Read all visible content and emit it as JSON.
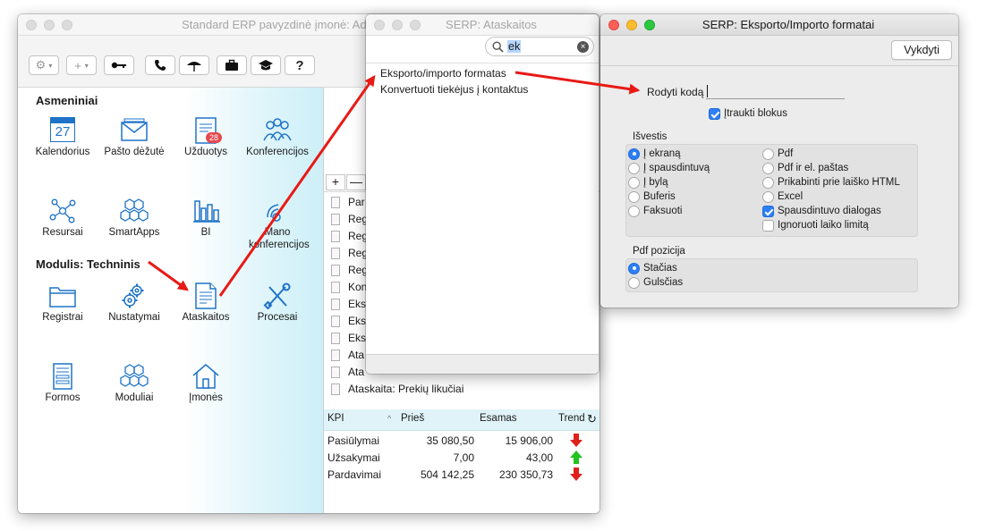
{
  "main_window": {
    "title": "Standard ERP pavyzdinė įmonė: Administratorius",
    "toolbar": {
      "help_label": "?"
    },
    "section_personal": "Asmeniniai",
    "section_module": "Modulis:  Techninis",
    "calendar_day": "27",
    "tasks_badge": "28",
    "icons": [
      {
        "label": "Kalendorius"
      },
      {
        "label": "Pašto dėžutė"
      },
      {
        "label": "Užduotys"
      },
      {
        "label": "Konferencijos"
      },
      {
        "label": "Resursai"
      },
      {
        "label": "SmartApps"
      },
      {
        "label": "BI"
      },
      {
        "label": "Mano konferencijos"
      },
      {
        "label": "Registrai"
      },
      {
        "label": "Nustatymai"
      },
      {
        "label": "Ataskaitos"
      },
      {
        "label": "Procesai"
      },
      {
        "label": "Formos"
      },
      {
        "label": "Moduliai"
      },
      {
        "label": "Įmonės"
      }
    ],
    "reports_panel": {
      "plus_label": "+",
      "minus_label": "—",
      "rows": [
        "Par",
        "Reg",
        "Reg",
        "Reg",
        "Reg",
        "Kon",
        "Eks",
        "Eks",
        "Eks",
        "Ata",
        "Ata",
        "Ataskaita: Prekių likučiai"
      ]
    },
    "kpi": {
      "headers": [
        "KPI",
        "Prieš",
        "Esamas",
        "Trend"
      ],
      "rows": [
        {
          "name": "Pasiūlymai",
          "before": "35 080,50",
          "current": "15 906,00",
          "trend": "down"
        },
        {
          "name": "Užsakymai",
          "before": "7,00",
          "current": "43,00",
          "trend": "up"
        },
        {
          "name": "Pardavimai",
          "before": "504 142,25",
          "current": "230 350,73",
          "trend": "down"
        }
      ]
    }
  },
  "reports_window": {
    "title": "SERP: Ataskaitos",
    "search_value": "ek",
    "items": [
      "Eksporto/importo formatas",
      "Konvertuoti tiekėjus į kontaktus"
    ]
  },
  "export_window": {
    "title": "SERP: Eksporto/Importo formatai",
    "run_button": "Vykdyti",
    "code_label": "Rodyti kodą",
    "code_value": "",
    "include_blocks_label": "Įtraukti blokus",
    "output_title": "Išvestis",
    "output_left": [
      "Į ekraną",
      "Į spausdintuvą",
      "Į bylą",
      "Buferis",
      "Faksuoti"
    ],
    "output_right": [
      "Pdf",
      "Pdf ir el. paštas",
      "Prikabinti prie laiško HTML",
      "Excel"
    ],
    "print_dialog_label": "Spausdintuvo dialogas",
    "ignore_time_label": "Ignoruoti laiko limitą",
    "pdf_title": "Pdf pozicija",
    "pdf_options": [
      "Stačias",
      "Gulsčias"
    ]
  },
  "colors": {
    "arrow": "#e81a16",
    "accent": "#2e7ff6",
    "trend_down": "#e0201b",
    "trend_up": "#22c21f"
  }
}
